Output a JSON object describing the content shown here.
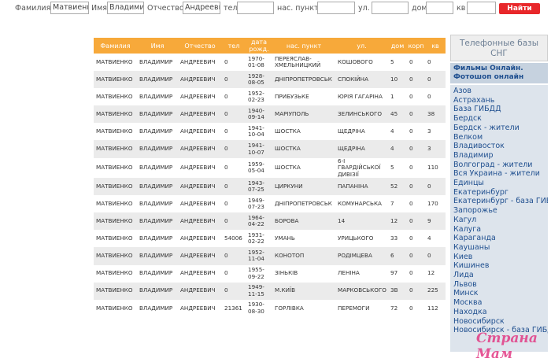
{
  "search": {
    "fields": [
      {
        "label": "Фамилия",
        "value": "Матвиенко"
      },
      {
        "label": "Имя",
        "value": "Владимир"
      },
      {
        "label": "Отчество",
        "value": "Андреевич"
      },
      {
        "label": "тел",
        "value": ""
      },
      {
        "label": "нас. пункт",
        "value": ""
      },
      {
        "label": "ул.",
        "value": ""
      },
      {
        "label": "дом",
        "value": ""
      },
      {
        "label": "кв",
        "value": ""
      }
    ],
    "submit_label": "Найти"
  },
  "table": {
    "headers": [
      "Фамилия",
      "Имя",
      "Отчество",
      "тел",
      "дата рожд.",
      "нас. пункт",
      "ул.",
      "дом",
      "корп",
      "кв"
    ],
    "rows": [
      [
        "МАТВИЕНКО",
        "ВЛАДИМИР",
        "АНДРЕЕВИЧ",
        "0",
        "1970-01-08",
        "ПЕРЕЯСЛАВ-ХМЕЛЬНИЦКИЙ",
        "КОШОВОГО",
        "5",
        "0",
        "0"
      ],
      [
        "МАТВИЕНКО",
        "ВЛАДИМИР",
        "АНДРЕЕВИЧ",
        "0",
        "1928-08-05",
        "ДНІПРОПЕТРОВСЬК",
        "СПОКІЙНА",
        "10",
        "0",
        "0"
      ],
      [
        "МАТВИЕНКО",
        "ВЛАДИМИР",
        "АНДРЕЕВИЧ",
        "0",
        "1952-02-23",
        "ПРИБУЗЬКЕ",
        "ЮРІЯ ГАГАРІНА",
        "1",
        "0",
        "0"
      ],
      [
        "МАТВИЕНКО",
        "ВЛАДИМИР",
        "АНДРЕЕВИЧ",
        "0",
        "1940-09-14",
        "МАРІУПОЛЬ",
        "ЗЕЛИНСЬКОГО",
        "45",
        "0",
        "38"
      ],
      [
        "МАТВИЕНКО",
        "ВЛАДИМИР",
        "АНДРЕЕВИЧ",
        "0",
        "1941-10-04",
        "ШОСТКА",
        "ЩЕДРІНА",
        "4",
        "0",
        "3"
      ],
      [
        "МАТВИЕНКО",
        "ВЛАДИМИР",
        "АНДРЕЕВИЧ",
        "0",
        "1941-10-07",
        "ШОСТКА",
        "ЩЕДРІНА",
        "4",
        "0",
        "3"
      ],
      [
        "МАТВИЕНКО",
        "ВЛАДИМИР",
        "АНДРЕЕВИЧ",
        "0",
        "1959-05-04",
        "ШОСТКА",
        "6-І ГВАРДІЙСЬКОЇ ДИВІЗІЇ",
        "5",
        "0",
        "110"
      ],
      [
        "МАТВИЕНКО",
        "ВЛАДИМИР",
        "АНДРЕЕВИЧ",
        "0",
        "1943-07-25",
        "ЦИРКУНИ",
        "ПАПАНІНА",
        "52",
        "0",
        "0"
      ],
      [
        "МАТВИЕНКО",
        "ВЛАДИМИР",
        "АНДРЕЕВИЧ",
        "0",
        "1949-07-23",
        "ДНІПРОПЕТРОВСЬК",
        "КОМУНАРСЬКА",
        "7",
        "0",
        "170"
      ],
      [
        "МАТВИЕНКО",
        "ВЛАДИМИР",
        "АНДРЕЕВИЧ",
        "0",
        "1964-04-22",
        "БОРОВА",
        "14",
        "12",
        "0",
        "9"
      ],
      [
        "МАТВИЕНКО",
        "ВЛАДИМИР",
        "АНДРЕЕВИЧ",
        "54006",
        "1931-02-22",
        "УМАНЬ",
        "УРИЦЬКОГО",
        "33",
        "0",
        "4"
      ],
      [
        "МАТВИЕНКО",
        "ВЛАДИМИР",
        "АНДРЕЕВИЧ",
        "0",
        "1952-11-04",
        "КОНОТОП",
        "РОДІМЦЕВА",
        "6",
        "0",
        "0"
      ],
      [
        "МАТВИЕНКО",
        "ВЛАДИМИР",
        "АНДРЕЕВИЧ",
        "0",
        "1955-09-22",
        "ЗІНЬКІВ",
        "ЛЕНІНА",
        "97",
        "0",
        "12"
      ],
      [
        "МАТВИЕНКО",
        "ВЛАДИМИР",
        "АНДРЕЕВИЧ",
        "0",
        "1949-11-15",
        "М.КИЇВ",
        "МАРКОВСЬКОГО",
        "3В",
        "0",
        "225"
      ],
      [
        "МАТВИЕНКО",
        "ВЛАДИМИР",
        "АНДРЕЕВИЧ",
        "21361",
        "1930-08-30",
        "ГОРЛІВКА",
        "ПЕРЕМОГИ",
        "72",
        "0",
        "112"
      ]
    ]
  },
  "sidebar": {
    "title": "Телефонные базы СНГ",
    "promo": "Фильмы Онлайн. Фотошоп онлайн",
    "cities": [
      "Азов",
      "Астрахань",
      "База ГИБДД",
      "Бердск",
      "Бердск - жители",
      "Велком",
      "Владивосток",
      "Владимир",
      "Волгоград - жители",
      "Вся Украина - жители",
      "Единцы",
      "Екатеринбург",
      "Екатеринбург - база ГИБДД",
      "Запорожье",
      "Кагул",
      "Калуга",
      "Караганда",
      "Каушаны",
      "Киев",
      "Кишинев",
      "Лида",
      "Львов",
      "Минск",
      "Москва",
      "Находка",
      "Новосибирск",
      "Новосибирск - база ГИБДД"
    ]
  },
  "watermark": "Страна Мам"
}
